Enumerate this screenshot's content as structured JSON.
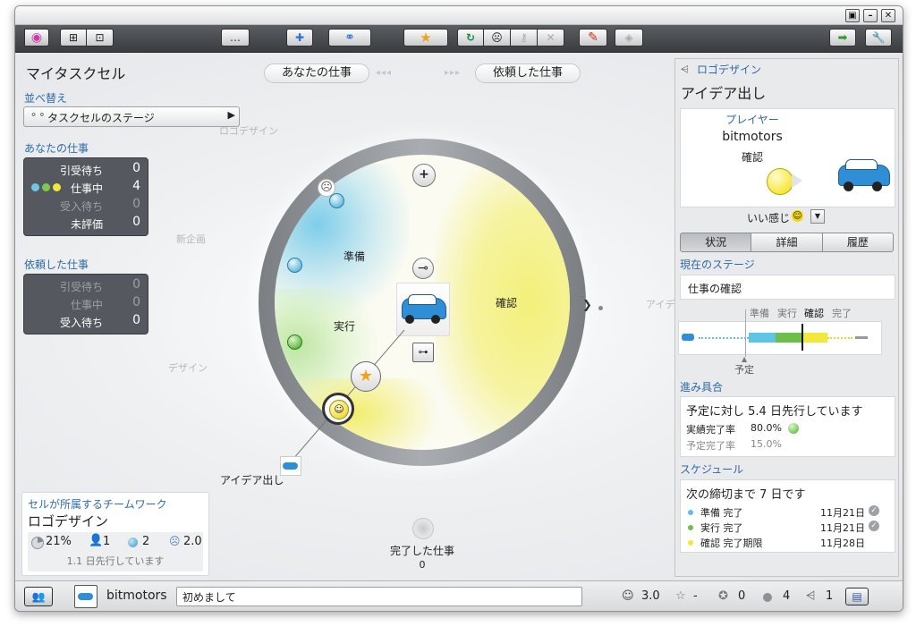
{
  "window": {
    "controls": [
      "▣",
      "–",
      "✕"
    ]
  },
  "toolbar": {
    "buttons": [
      {
        "name": "home-icon",
        "glyph": "◉"
      },
      {
        "name": "hierarchy-icon",
        "glyph": "⊞"
      },
      {
        "name": "grid-icon",
        "glyph": "⊡"
      },
      {
        "name": "chat-icon",
        "glyph": "…"
      },
      {
        "name": "add-cell-icon",
        "glyph": "✚"
      },
      {
        "name": "link-icon",
        "glyph": "⚭"
      },
      {
        "name": "star-icon",
        "glyph": "★"
      },
      {
        "name": "refresh-icon",
        "glyph": "↻"
      },
      {
        "name": "face-icon",
        "glyph": "☹"
      },
      {
        "name": "key-icon",
        "glyph": "⚷"
      },
      {
        "name": "delete-icon",
        "glyph": "✕"
      },
      {
        "name": "pencil-icon",
        "glyph": "✎"
      },
      {
        "name": "stamp-icon",
        "glyph": "◈"
      },
      {
        "name": "export-icon",
        "glyph": "➡"
      },
      {
        "name": "wrench-icon",
        "glyph": "🔧"
      }
    ]
  },
  "left": {
    "title": "マイタスクセル",
    "sort_label": "並べ替え",
    "sort_value": "タスクセルのステージ",
    "my_work_label": "あなたの仕事",
    "my_work": [
      {
        "label": "引受待ち",
        "value": "0"
      },
      {
        "label": "仕事中",
        "value": "4"
      },
      {
        "label": "受入待ち",
        "value": "0"
      },
      {
        "label": "未評価",
        "value": "0"
      }
    ],
    "requested_label": "依頼した仕事",
    "requested": [
      {
        "label": "引受待ち",
        "value": "0"
      },
      {
        "label": "仕事中",
        "value": "0"
      },
      {
        "label": "受入待ち",
        "value": "0"
      }
    ],
    "team_label": "セルが所属するチームワーク",
    "team_name": "ロゴデザイン",
    "team_stats": {
      "percent": "21%",
      "members": "1",
      "cells": "2",
      "rating": "2.0"
    },
    "team_note": "1.1 日先行しています"
  },
  "center": {
    "tab_my": "あなたの仕事",
    "tab_requested": "依頼した仕事",
    "arrows_left": "◂◂◂",
    "arrows_right": "▸▸▸",
    "ghost_labels": [
      "ロゴデザイン",
      "新企画",
      "デザイン",
      "アイデ"
    ],
    "stages": {
      "prep": "準備",
      "exec": "実行",
      "confirm": "確認"
    },
    "task_label": "アイデア出し",
    "done_label": "完了した仕事",
    "done_count": "0",
    "colors": {
      "blue": "#7ecdea",
      "green": "#8dd36f",
      "yellow": "#f4f07a"
    }
  },
  "right": {
    "breadcrumb": "ロゴデザイン",
    "title": "アイデア出し",
    "player_label": "プレイヤー",
    "player_name": "bitmotors",
    "player_status": "確認",
    "feeling": "いい感じ",
    "tabs": [
      "状況",
      "詳細",
      "履歴"
    ],
    "current_stage_label": "現在のステージ",
    "current_stage": "仕事の確認",
    "stage_names": [
      "準備",
      "実行",
      "確認",
      "完了"
    ],
    "planned_label": "予定",
    "progress_label": "進み具合",
    "progress_headline": "予定に対し 5.4 日先行しています",
    "actual_label": "実績完了率",
    "actual_value": "80.0%",
    "planned_rate_label": "予定完了率",
    "planned_rate_value": "15.0%",
    "schedule_label": "スケジュール",
    "schedule_headline": "次の締切まで 7 日です",
    "schedule": [
      {
        "label": "準備 完了",
        "date": "11月21日",
        "color": "#63bfe0",
        "done": true
      },
      {
        "label": "実行 完了",
        "date": "11月21日",
        "color": "#6cc04a",
        "done": true
      },
      {
        "label": "確認 完了期限",
        "date": "11月28日",
        "color": "#f0e83a",
        "done": false
      }
    ]
  },
  "status": {
    "user": "bitmotors",
    "message": "初めまして",
    "rating": "3.0",
    "stars": "-",
    "badges": "0",
    "cells": "4",
    "links": "1"
  }
}
